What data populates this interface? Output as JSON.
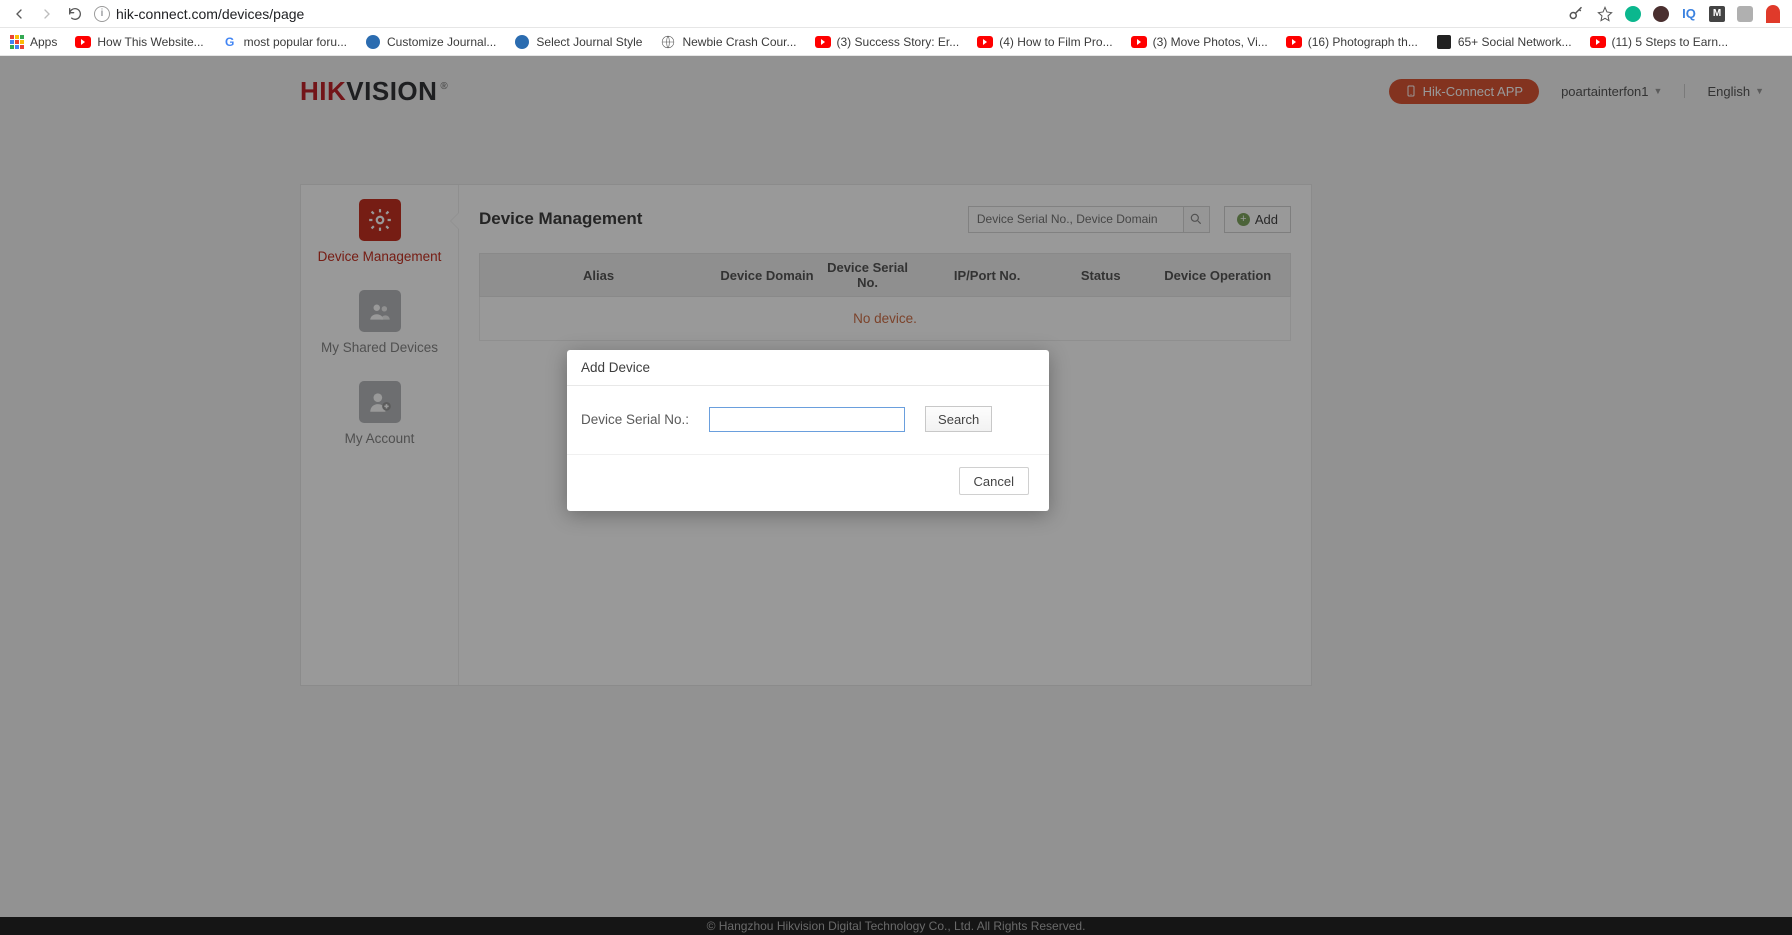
{
  "browser": {
    "url": "hik-connect.com/devices/page",
    "bookmarks": {
      "apps": "Apps",
      "items": [
        {
          "label": "How This Website...",
          "icon": "yt"
        },
        {
          "label": "most popular foru...",
          "icon": "g"
        },
        {
          "label": "Customize Journal...",
          "icon": "blue"
        },
        {
          "label": "Select Journal Style",
          "icon": "blue"
        },
        {
          "label": "Newbie Crash Cour...",
          "icon": "globe"
        },
        {
          "label": "(3) Success Story: Er...",
          "icon": "yt"
        },
        {
          "label": "(4) How to Film Pro...",
          "icon": "yt"
        },
        {
          "label": "(3) Move Photos, Vi...",
          "icon": "yt"
        },
        {
          "label": "(16) Photograph th...",
          "icon": "yt"
        },
        {
          "label": "65+ Social Network...",
          "icon": "sq"
        },
        {
          "label": "(11) 5 Steps to Earn...",
          "icon": "yt"
        }
      ]
    }
  },
  "header": {
    "logo_a": "HIK",
    "logo_b": "VISION",
    "app_button": "Hik-Connect APP",
    "username": "poartainterfon1",
    "language": "English"
  },
  "sidebar": {
    "items": [
      {
        "label": "Device Management"
      },
      {
        "label": "My Shared Devices"
      },
      {
        "label": "My Account"
      }
    ]
  },
  "main": {
    "title": "Device Management",
    "search_placeholder": "Device Serial No., Device Domain",
    "add_label": "Add",
    "columns": {
      "alias": "Alias",
      "domain": "Device Domain",
      "serial": "Device Serial No.",
      "ipport": "IP/Port No.",
      "status": "Status",
      "operation": "Device Operation"
    },
    "empty": "No device."
  },
  "modal": {
    "title": "Add Device",
    "field_label": "Device Serial No.:",
    "field_value": "",
    "search_label": "Search",
    "cancel_label": "Cancel"
  },
  "footer": "© Hangzhou Hikvision Digital Technology Co., Ltd. All Rights Reserved."
}
